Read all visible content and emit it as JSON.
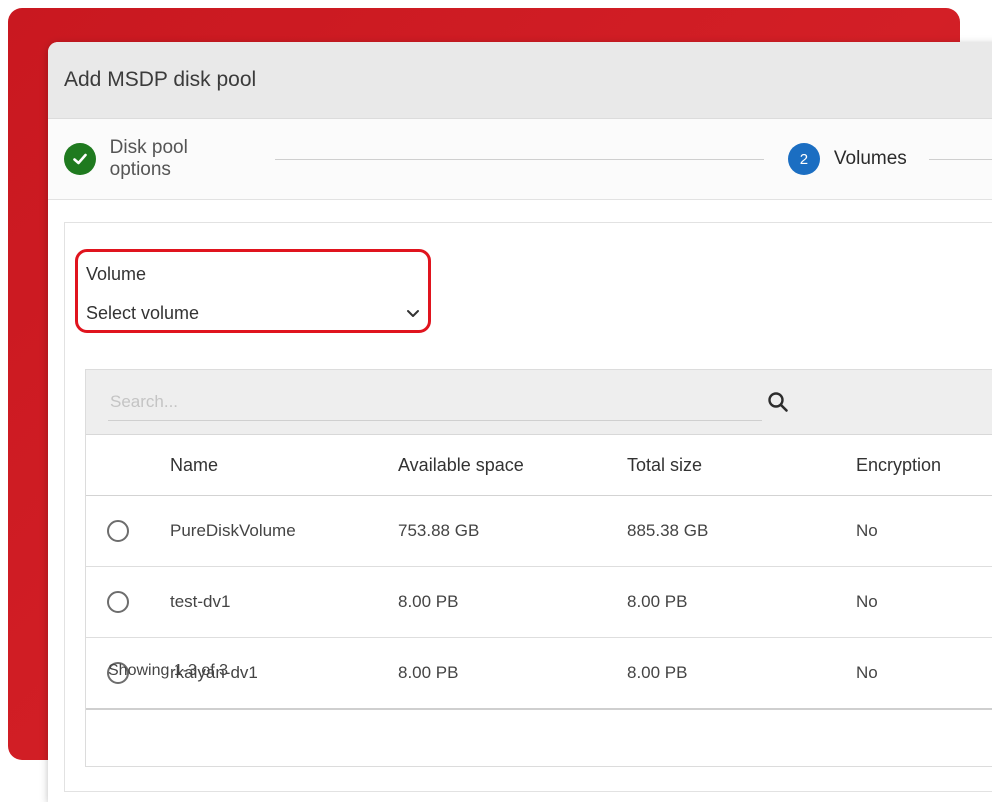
{
  "dialog": {
    "title": "Add MSDP disk pool"
  },
  "stepper": {
    "steps": [
      {
        "label": "Disk pool options",
        "status": "done"
      },
      {
        "number": "2",
        "label": "Volumes",
        "status": "active"
      }
    ]
  },
  "volume": {
    "label": "Volume",
    "placeholder": "Select volume"
  },
  "search": {
    "placeholder": "Search..."
  },
  "table": {
    "columns": [
      "Name",
      "Available space",
      "Total size",
      "Encryption"
    ],
    "rows": [
      {
        "name": "PureDiskVolume",
        "available": "753.88 GB",
        "total": "885.38 GB",
        "encryption": "No"
      },
      {
        "name": "test-dv1",
        "available": "8.00 PB",
        "total": "8.00 PB",
        "encryption": "No"
      },
      {
        "name": "rkalyan-dv1",
        "available": "8.00 PB",
        "total": "8.00 PB",
        "encryption": "No"
      }
    ],
    "footer": "Showing 1-3 of 3"
  },
  "colors": {
    "accent_red": "#e0141e",
    "step_done": "#1f7a1f",
    "step_active": "#1b6ec2"
  },
  "icons": {
    "step_done": "check-circle-icon",
    "dropdown": "chevron-down-icon",
    "search": "search-icon",
    "row_select": "radio-icon"
  }
}
